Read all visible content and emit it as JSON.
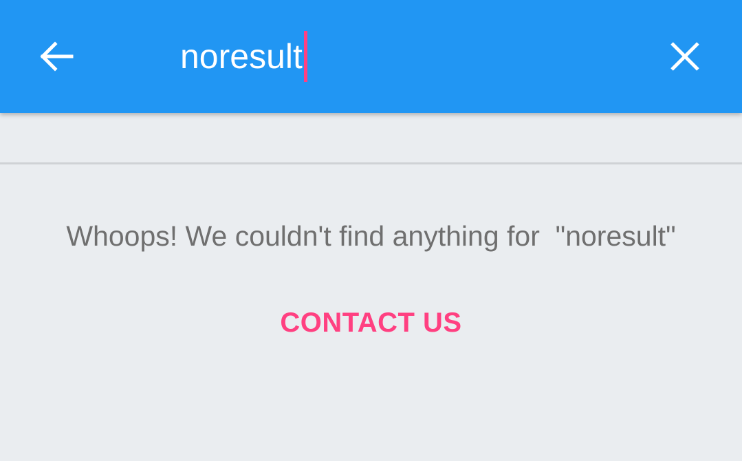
{
  "appbar": {
    "background_color": "#2196f3",
    "back_icon": "arrow-left-icon",
    "close_icon": "close-icon"
  },
  "search": {
    "value": "noresult",
    "caret_color": "#ff4081"
  },
  "empty_state": {
    "message": "Whoops! We couldn't find anything for  \"noresult\"",
    "contact_label": "CONTACT US",
    "accent_color": "#ff4081"
  }
}
